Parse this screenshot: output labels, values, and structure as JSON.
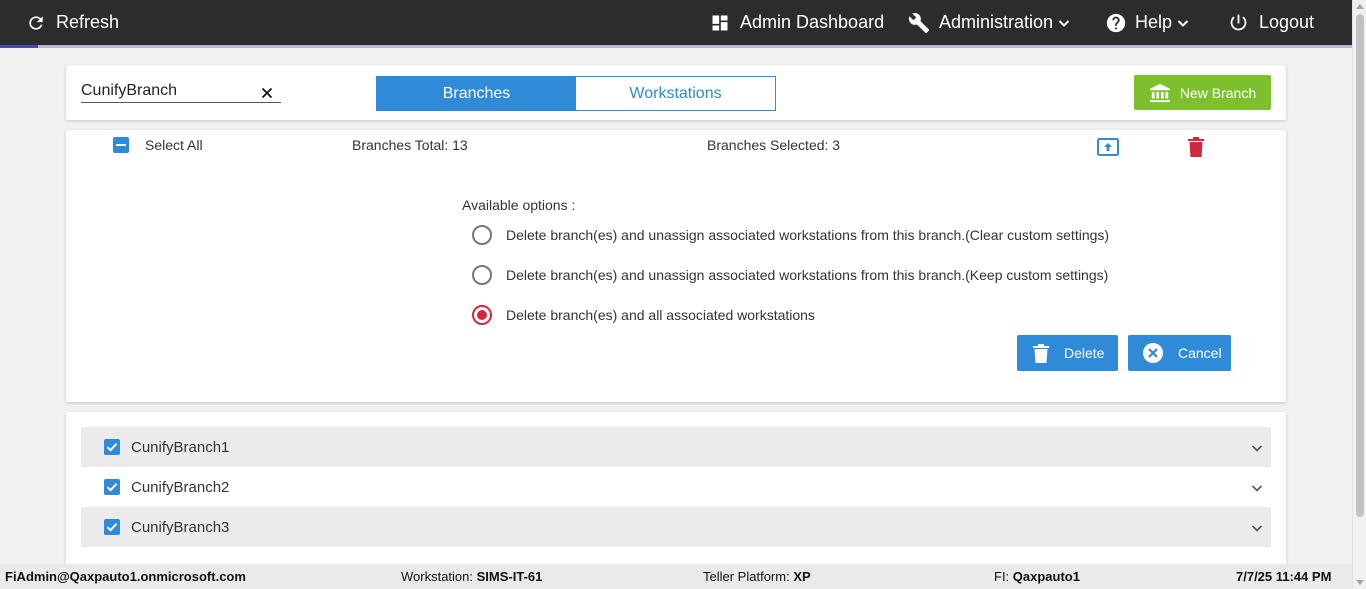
{
  "topbar": {
    "refresh_label": "Refresh",
    "admin_dashboard_label": "Admin Dashboard",
    "administration_label": "Administration",
    "help_label": "Help",
    "logout_label": "Logout",
    "load_progress": 0.028
  },
  "search": {
    "value": "CunifyBranch"
  },
  "tabs": [
    {
      "label": "Branches",
      "active": true
    },
    {
      "label": "Workstations",
      "active": false
    }
  ],
  "new_branch_label": "New Branch",
  "selection": {
    "select_all_label": "Select All",
    "branches_total": "Branches Total: 13",
    "branches_selected": "Branches Selected: 3"
  },
  "delete_panel": {
    "options_title": "Available options :",
    "options": [
      {
        "label": "Delete branch(es) and unassign associated workstations from this branch.(Clear custom settings)",
        "selected": false
      },
      {
        "label": "Delete branch(es) and unassign associated workstations from this branch.(Keep custom settings)",
        "selected": false
      },
      {
        "label": "Delete branch(es) and all associated workstations",
        "selected": true
      }
    ],
    "delete_label": "Delete",
    "cancel_label": "Cancel"
  },
  "branches": [
    {
      "name": "CunifyBranch1",
      "checked": true
    },
    {
      "name": "CunifyBranch2",
      "checked": true
    },
    {
      "name": "CunifyBranch3",
      "checked": true
    }
  ],
  "footer": {
    "user": "FiAdmin@Qaxpauto1.onmicrosoft.com",
    "workstation_label": "Workstation: ",
    "workstation_value": "SIMS-IT-61",
    "teller_label": "Teller Platform: ",
    "teller_value": "XP",
    "fi_label": "FI: ",
    "fi_value": "Qaxpauto1",
    "datetime": "7/7/25 11:44 PM"
  },
  "colors": {
    "topbar": "#2c2c2c",
    "primary_blue": "#2f8ad8",
    "new_branch_green": "#7dc02e",
    "danger_red": "#d0283f"
  }
}
